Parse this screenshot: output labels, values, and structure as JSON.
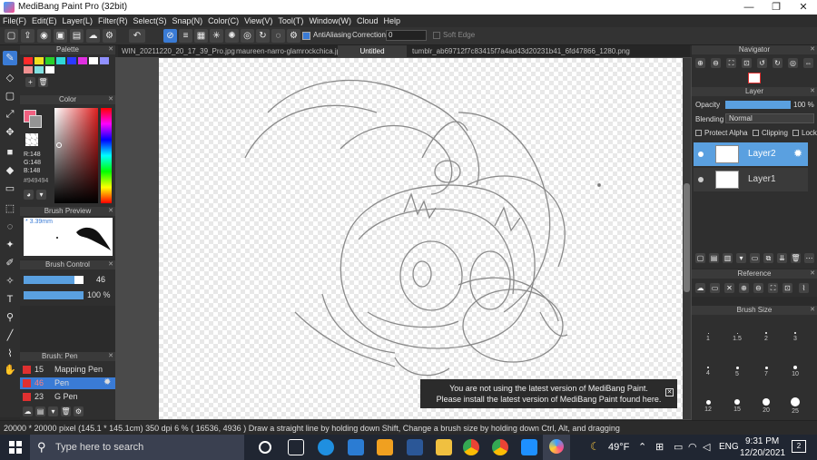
{
  "window": {
    "title": "MediBang Paint Pro (32bit)",
    "minimize": "—",
    "maximize": "❐",
    "close": "✕"
  },
  "menu": [
    "File(F)",
    "Edit(E)",
    "Layer(L)",
    "Filter(R)",
    "Select(S)",
    "Snap(N)",
    "Color(C)",
    "View(V)",
    "Tool(T)",
    "Window(W)",
    "Cloud",
    "Help"
  ],
  "toolbar": {
    "antialiasing": "AntiAliasing",
    "correction_label": "Correction",
    "correction_value": "0",
    "soft_edge": "Soft Edge"
  },
  "tabs": [
    "WIN_20211220_20_17_39_Pro.jpg",
    "maureen-narro-glamrockchica.jpg",
    "Untitled",
    "tumblr_ab69712f7c83415f7a4ad43d20231b41_6fd47866_1280.png"
  ],
  "palette": {
    "title": "Palette",
    "colors": [
      "#ff2a2a",
      "#f0e020",
      "#2ad02a",
      "#30d8d8",
      "#2a3aff",
      "#e030e0",
      "#ffffff",
      "#9090ff",
      "#f09090",
      "#80e0e0",
      "#ffffff"
    ]
  },
  "color": {
    "title": "Color",
    "r": "R:148",
    "g": "G:148",
    "b": "B:148",
    "hex": "#949494"
  },
  "brush_preview": {
    "title": "Brush Preview",
    "size": "* 3.39mm"
  },
  "brush_control": {
    "title": "Brush Control",
    "size_value": "46",
    "opacity_value": "100 %"
  },
  "brush_list": {
    "title": "Brush: Pen",
    "items": [
      {
        "num": "15",
        "name": "Mapping Pen",
        "color": "#e03030"
      },
      {
        "num": "46",
        "name": "Pen",
        "color": "#e03030"
      },
      {
        "num": "23",
        "name": "G Pen",
        "color": "#e03030"
      }
    ]
  },
  "navigator": {
    "title": "Navigator"
  },
  "layer_panel": {
    "title": "Layer",
    "opacity_label": "Opacity",
    "opacity_value": "100 %",
    "blending_label": "Blending",
    "blending_value": "Normal",
    "protect_alpha": "Protect Alpha",
    "clipping": "Clipping",
    "lock": "Lock",
    "layers": [
      "Layer2",
      "Layer1"
    ]
  },
  "reference": {
    "title": "Reference"
  },
  "brush_size": {
    "title": "Brush Size",
    "labels": [
      "1",
      "1.5",
      "2",
      "3",
      "4",
      "5",
      "7",
      "10",
      "12",
      "15",
      "20",
      "25"
    ]
  },
  "notice": {
    "line1": "You are not using the latest version of MediBang Paint.",
    "line2": "Please install the latest version of MediBang Paint found here."
  },
  "status": {
    "text": "20000 * 20000 pixel  (145.1 * 145.1cm)  350 dpi  6 %  ( 16536, 4936 )  Draw a straight line by holding down Shift, Change a brush size by holding down Ctrl, Alt, and dragging"
  },
  "taskbar": {
    "search_placeholder": "Type here to search",
    "weather": "49°F",
    "lang": "ENG",
    "time": "9:31 PM",
    "date": "12/20/2021",
    "notifications": "2"
  }
}
